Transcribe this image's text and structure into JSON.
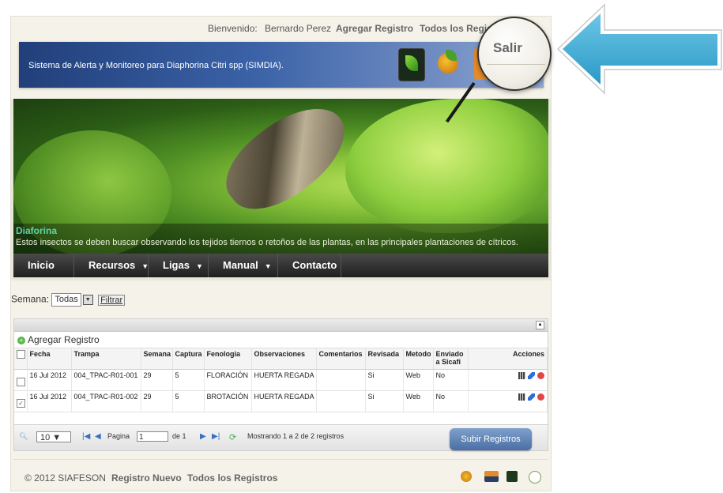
{
  "topbar": {
    "greeting": "Bienvenido:",
    "user": "Bernardo Perez",
    "add_record": "Agregar Registro",
    "all_records": "Todos los Regis"
  },
  "header": {
    "system_title": "Sistema de Alerta y Monitoreo para Diaphorina Citri spp (SIMDIA)."
  },
  "hero": {
    "caption_title": "Diaforina",
    "caption_text": "Estos insectos se deben buscar observando los tejidos tiernos o retoños de las plantas, en las principales plantaciones de cítricos."
  },
  "nav": {
    "items": [
      {
        "label": "Inicio",
        "caret": ""
      },
      {
        "label": "Recursos",
        "caret": "▼"
      },
      {
        "label": "Ligas",
        "caret": "▼"
      },
      {
        "label": "Manual",
        "caret": "▼"
      },
      {
        "label": "Contacto",
        "caret": ""
      }
    ]
  },
  "filter": {
    "label": "Semana:",
    "selected": "Todas",
    "button": "Filtrar"
  },
  "grid": {
    "add_label": "Agregar Registro",
    "columns": [
      "Fecha",
      "Trampa",
      "Semana",
      "Captura",
      "Fenologia",
      "Observaciones",
      "Comentarios",
      "Revisada",
      "Metodo",
      "Enviado a Sicafi",
      "Acciones"
    ],
    "rows": [
      {
        "checked": false,
        "check_mark": "",
        "fecha": "16 Jul 2012",
        "trampa": "004_TPAC-R01-001",
        "semana": "29",
        "captura": "5",
        "fenologia": "FLORACIÓN",
        "observaciones": "HUERTA REGADA",
        "comentarios": "",
        "revisada": "Si",
        "metodo": "Web",
        "enviado": "No"
      },
      {
        "checked": true,
        "check_mark": "✓",
        "fecha": "16 Jul 2012",
        "trampa": "004_TPAC-R01-002",
        "semana": "29",
        "captura": "5",
        "fenologia": "BROTACIÓN",
        "observaciones": "HUERTA REGADA",
        "comentarios": "",
        "revisada": "Si",
        "metodo": "Web",
        "enviado": "No"
      }
    ]
  },
  "pager": {
    "page_size": "10",
    "page_label": "Pagina",
    "page_value": "1",
    "of_label": "de 1",
    "status": "Mostrando 1 a 2 de 2 registros",
    "upload_button": "Subir Registros"
  },
  "footer": {
    "copyright": "© 2012 SIAFESON",
    "new_record": "Registro Nuevo",
    "all_records": "Todos los Registros"
  },
  "callout": {
    "label": "Salir"
  }
}
